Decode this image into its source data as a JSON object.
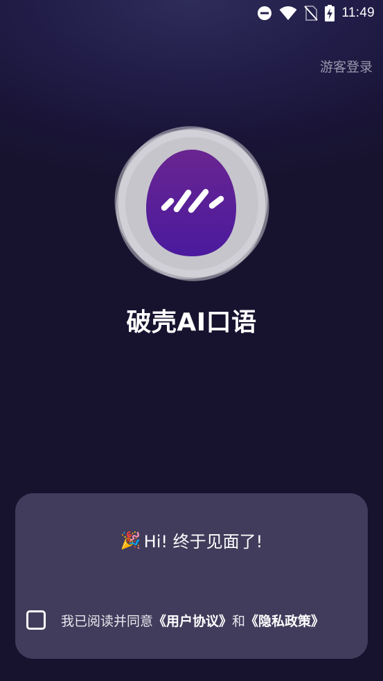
{
  "status_bar": {
    "time": "11:49",
    "icons": [
      "do-not-disturb-icon",
      "wifi-icon",
      "no-sim-icon",
      "battery-charging-icon"
    ]
  },
  "header": {
    "guest_login": "游客登录"
  },
  "app": {
    "logo_icon": "egg-wave-logo-icon",
    "title": "破壳AI口语"
  },
  "card": {
    "greeting_emoji": "🎉",
    "greeting_text": "Hi! 终于见面了!",
    "agreement": {
      "checked": false,
      "prefix": "我已阅读并同意",
      "user_agreement": "《用户协议》",
      "conjunction": "和",
      "privacy_policy": "《隐私政策》"
    }
  },
  "colors": {
    "background": "#1a1538",
    "card": "#413c5b",
    "logo_purple_top": "#6a2590",
    "logo_purple_bottom": "#4a1a9e",
    "guest_login": "#9a97ad"
  }
}
